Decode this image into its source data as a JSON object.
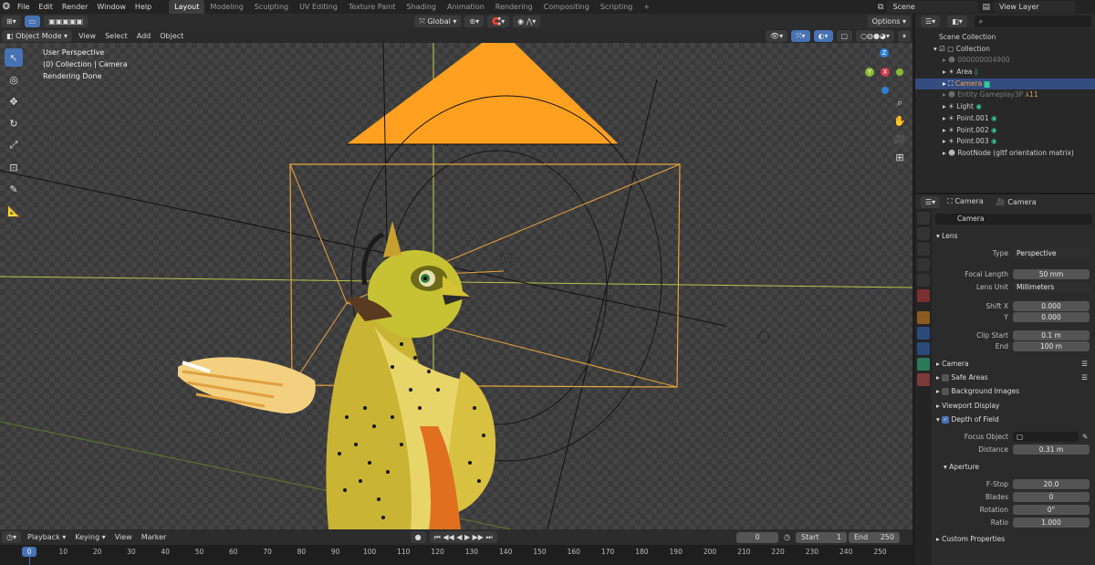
{
  "topbar": {
    "menus": [
      "File",
      "Edit",
      "Render",
      "Window",
      "Help"
    ],
    "workspaces": [
      "Layout",
      "Modeling",
      "Sculpting",
      "UV Editing",
      "Texture Paint",
      "Shading",
      "Animation",
      "Rendering",
      "Compositing",
      "Scripting"
    ],
    "active_workspace": "Layout",
    "plus": "+",
    "scene": "Scene",
    "view_layer": "View Layer"
  },
  "viewport_header": {
    "mode": "Object Mode",
    "menus": [
      "View",
      "Select",
      "Add",
      "Object"
    ],
    "transform_orientation": "Global",
    "options": "Options"
  },
  "overlay": {
    "line1": "User Perspective",
    "line2": "(0) Collection | Camera",
    "line3": "Rendering Done"
  },
  "gizmo": {
    "z": "Z",
    "y": "Y",
    "x": "X"
  },
  "outliner": {
    "root": "Scene Collection",
    "items": [
      {
        "label": "Collection",
        "indent": 1,
        "state": "normal"
      },
      {
        "label": "000000004900",
        "indent": 2,
        "state": "dim"
      },
      {
        "label": "Area",
        "indent": 2,
        "state": "normal"
      },
      {
        "label": "Camera",
        "indent": 2,
        "state": "selected"
      },
      {
        "label": "Entity Gameplay3P",
        "indent": 2,
        "state": "dim"
      },
      {
        "label": "Light",
        "indent": 2,
        "state": "normal"
      },
      {
        "label": "Point.001",
        "indent": 2,
        "state": "normal"
      },
      {
        "label": "Point.002",
        "indent": 2,
        "state": "normal"
      },
      {
        "label": "Point.003",
        "indent": 2,
        "state": "normal"
      },
      {
        "label": "RootNode (gltf orientation matrix)",
        "indent": 2,
        "state": "normal"
      }
    ],
    "badge_entity": "11"
  },
  "properties": {
    "header_object": "Camera",
    "header_data": "Camera",
    "datablock": "Camera",
    "lens_section": "Lens",
    "type_label": "Type",
    "type_value": "Perspective",
    "focal_label": "Focal Length",
    "focal_value": "50 mm",
    "unit_label": "Lens Unit",
    "unit_value": "Millimeters",
    "shiftx_label": "Shift X",
    "shiftx_value": "0.000",
    "shifty_label": "Y",
    "shifty_value": "0.000",
    "clipstart_label": "Clip Start",
    "clipstart_value": "0.1 m",
    "clipend_label": "End",
    "clipend_value": "100 m",
    "camera_section": "Camera",
    "safe_areas": "Safe Areas",
    "bg_images": "Background Images",
    "viewport_display": "Viewport Display",
    "dof": "Depth of Field",
    "focus_label": "Focus Object",
    "distance_label": "Distance",
    "distance_value": "0.31 m",
    "aperture_section": "Aperture",
    "fstop_label": "F-Stop",
    "fstop_value": "20.0",
    "blades_label": "Blades",
    "blades_value": "0",
    "rotation_label": "Rotation",
    "rotation_value": "0°",
    "ratio_label": "Ratio",
    "ratio_value": "1.000",
    "custom_props": "Custom Properties"
  },
  "timeline": {
    "menus": [
      "Playback",
      "Keying",
      "View",
      "Marker"
    ],
    "current_frame": "0",
    "start_label": "Start",
    "start_value": "1",
    "end_label": "End",
    "end_value": "250",
    "ticks": [
      "0",
      "10",
      "20",
      "30",
      "40",
      "50",
      "60",
      "70",
      "80",
      "90",
      "100",
      "110",
      "120",
      "130",
      "140",
      "150",
      "160",
      "170",
      "180",
      "190",
      "200",
      "210",
      "220",
      "230",
      "240",
      "250"
    ]
  },
  "colors": {
    "accent": "#4772b3",
    "light_orange": "#ffa020",
    "camera_frame": "#e8a33c",
    "selection": "#334d80"
  }
}
